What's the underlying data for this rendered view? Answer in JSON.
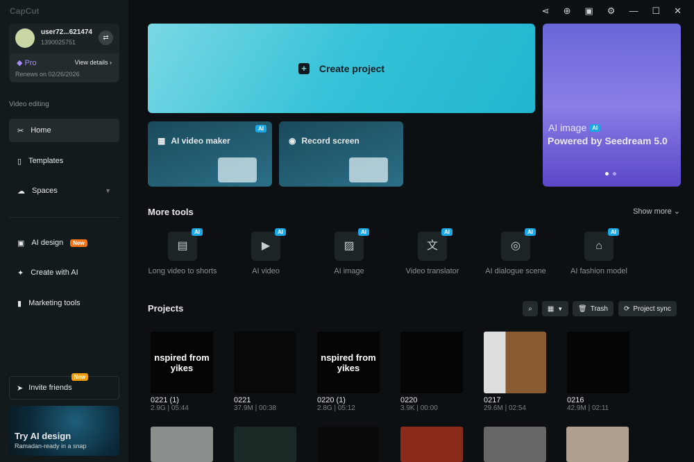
{
  "app": {
    "name": "CapCut"
  },
  "user": {
    "name": "user72...621474",
    "id": "1390025751",
    "plan": "Pro",
    "view_details": "View details",
    "renews": "Renews on 02/26/2026"
  },
  "sidebar": {
    "section": "Video editing",
    "items": [
      {
        "label": "Home"
      },
      {
        "label": "Templates"
      },
      {
        "label": "Spaces"
      }
    ],
    "extra": [
      {
        "label": "AI design",
        "badge": "New"
      },
      {
        "label": "Create with AI"
      },
      {
        "label": "Marketing tools"
      }
    ],
    "invite": {
      "label": "Invite friends",
      "badge": "New"
    },
    "promo": {
      "title": "Try AI design",
      "subtitle": "Ramadan-ready in a snap"
    }
  },
  "hero": {
    "create": "Create project",
    "cards": [
      {
        "label": "AI video maker",
        "badge": "AI"
      },
      {
        "label": "Record screen"
      }
    ],
    "banner": {
      "title": "AI image",
      "badge": "AI",
      "subtitle": "Powered by Seedream 5.0"
    }
  },
  "more_tools": {
    "title": "More tools",
    "show_more": "Show more",
    "tools": [
      {
        "label": "Long video to shorts",
        "icon": "film-icon"
      },
      {
        "label": "AI video",
        "icon": "play-icon"
      },
      {
        "label": "AI image",
        "icon": "image-icon"
      },
      {
        "label": "Video translator",
        "icon": "translate-icon"
      },
      {
        "label": "AI dialogue scene",
        "icon": "dialogue-icon"
      },
      {
        "label": "AI fashion model",
        "icon": "shirt-icon"
      }
    ],
    "badge": "AI"
  },
  "projects": {
    "title": "Projects",
    "trash": "Trash",
    "sync": "Project sync",
    "items": [
      {
        "name": "0221 (1)",
        "meta": "2.9G | 05:44",
        "thumb_text": "nspired from yikes"
      },
      {
        "name": "0221",
        "meta": "37.9M | 00:38"
      },
      {
        "name": "0220 (1)",
        "meta": "2.8G | 05:12",
        "thumb_text": "nspired from yikes"
      },
      {
        "name": "0220",
        "meta": "3.9K | 00:00"
      },
      {
        "name": "0217",
        "meta": "29.6M | 02:54"
      },
      {
        "name": "0216",
        "meta": "42.9M | 02:11"
      }
    ]
  }
}
